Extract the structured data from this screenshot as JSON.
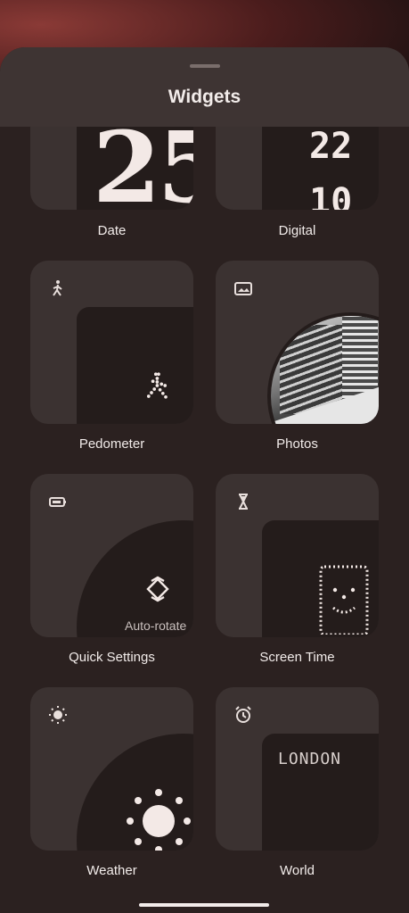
{
  "sheet": {
    "title": "Widgets"
  },
  "widgets": [
    {
      "label": "Date",
      "preview_text": "25"
    },
    {
      "label": "Digital",
      "preview_text": "22 10"
    },
    {
      "label": "Pedometer",
      "icon": "walking-person-icon"
    },
    {
      "label": "Photos",
      "icon": "image-icon"
    },
    {
      "label": "Quick Settings",
      "icon": "battery-icon",
      "preview_text": "Auto-rotate"
    },
    {
      "label": "Screen Time",
      "icon": "hourglass-icon"
    },
    {
      "label": "Weather",
      "icon": "sun-icon"
    },
    {
      "label": "World",
      "icon": "alarm-clock-icon",
      "preview_text": "LONDON"
    }
  ],
  "colors": {
    "sheet": "#2b2120",
    "tile": "#3b3231",
    "inner": "#241c1b",
    "text": "#f2ecea"
  }
}
